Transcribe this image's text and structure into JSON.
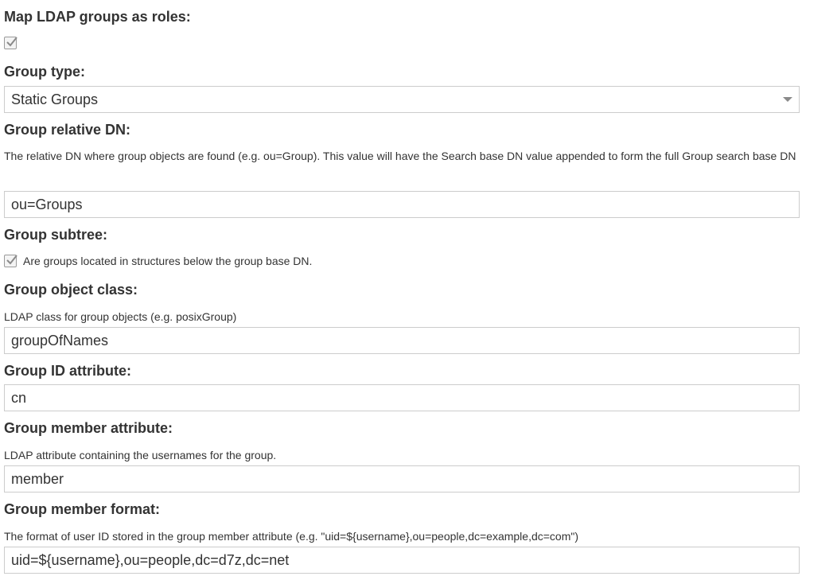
{
  "fields": {
    "map_groups": {
      "label": "Map LDAP groups as roles:",
      "checked": true
    },
    "group_type": {
      "label": "Group type:",
      "value": "Static Groups"
    },
    "group_relative_dn": {
      "label": "Group relative DN:",
      "help": "The relative DN where group objects are found (e.g. ou=Group). This value will have the Search base DN value appended to form the full Group search base DN",
      "value": "ou=Groups"
    },
    "group_subtree": {
      "label": "Group subtree:",
      "checkbox_label": "Are groups located in structures below the group base DN.",
      "checked": true
    },
    "group_object_class": {
      "label": "Group object class:",
      "help": "LDAP class for group objects (e.g. posixGroup)",
      "value": "groupOfNames"
    },
    "group_id_attribute": {
      "label": "Group ID attribute:",
      "value": "cn"
    },
    "group_member_attribute": {
      "label": "Group member attribute:",
      "help": "LDAP attribute containing the usernames for the group.",
      "value": "member"
    },
    "group_member_format": {
      "label": "Group member format:",
      "help": "The format of user ID stored in the group member attribute (e.g. \"uid=${username},ou=people,dc=example,dc=com\")",
      "value": "uid=${username},ou=people,dc=d7z,dc=net"
    }
  },
  "icons": {
    "checkmark": "check-icon",
    "dropdown": "chevron-down-icon"
  },
  "colors": {
    "text": "#333333",
    "border": "#cccccc",
    "check": "#8a8a8a"
  }
}
